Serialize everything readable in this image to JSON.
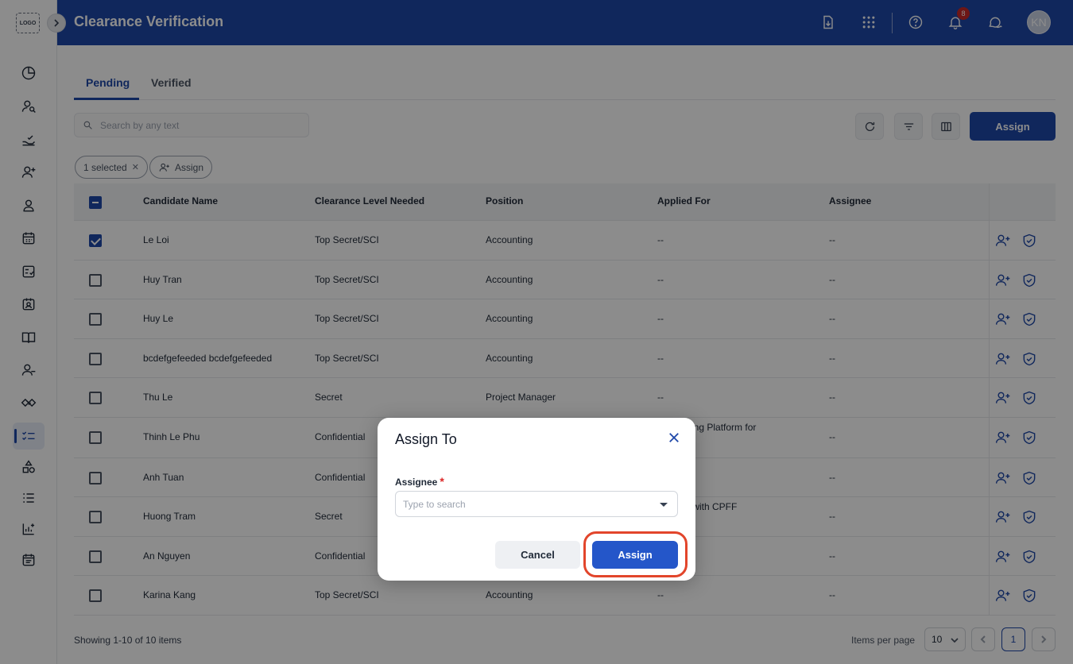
{
  "app": {
    "logo_text": "LOGO",
    "title": "Clearance Verification",
    "notification_count": "8",
    "user_initials": "KN"
  },
  "sidebar": {
    "items": [
      {
        "icon": "pie-chart-icon"
      },
      {
        "icon": "user-search-icon"
      },
      {
        "icon": "hand-check-icon"
      },
      {
        "icon": "user-add-icon"
      },
      {
        "icon": "user-icon"
      },
      {
        "icon": "calendar-icon"
      },
      {
        "icon": "checklist-doc-icon"
      },
      {
        "icon": "contact-card-icon"
      },
      {
        "icon": "book-open-icon"
      },
      {
        "icon": "user-minus-icon"
      },
      {
        "icon": "handshake-icon"
      },
      {
        "icon": "list-check-icon",
        "active": true
      },
      {
        "icon": "shapes-icon"
      },
      {
        "icon": "numbered-list-icon"
      },
      {
        "icon": "chart-add-icon"
      },
      {
        "icon": "calendar-notes-icon"
      }
    ]
  },
  "tabs": [
    {
      "label": "Pending",
      "active": true
    },
    {
      "label": "Verified",
      "active": false
    }
  ],
  "search": {
    "placeholder": "Search by any text"
  },
  "toolbar": {
    "assign_label": "Assign"
  },
  "selection": {
    "selected_label": "1 selected",
    "assign_label": "Assign"
  },
  "table": {
    "columns": [
      "Candidate Name",
      "Clearance Level Needed",
      "Position",
      "Applied For",
      "Assignee"
    ],
    "rows": [
      {
        "name": "Le Loi",
        "clearance": "Top Secret/SCI",
        "position": "Accounting",
        "applied_for": "--",
        "assignee": "--",
        "checked": true
      },
      {
        "name": "Huy Tran",
        "clearance": "Top Secret/SCI",
        "position": "Accounting",
        "applied_for": "--",
        "assignee": "--",
        "checked": false
      },
      {
        "name": "Huy Le",
        "clearance": "Top Secret/SCI",
        "position": "Accounting",
        "applied_for": "--",
        "assignee": "--",
        "checked": false
      },
      {
        "name": "bcdefgefeeded bcdefgefeeded",
        "clearance": "Top Secret/SCI",
        "position": "Accounting",
        "applied_for": "--",
        "assignee": "--",
        "checked": false
      },
      {
        "name": "Thu Le",
        "clearance": "Secret",
        "position": "Project Manager",
        "applied_for": "--",
        "assignee": "--",
        "checked": false
      },
      {
        "name": "Thinh Le Phu",
        "clearance": "Confidential",
        "position": "",
        "applied_for": "eting Platform for",
        "assignee": "--",
        "checked": false
      },
      {
        "name": "Anh Tuan",
        "clearance": "Confidential",
        "position": "",
        "applied_for": "",
        "assignee": "--",
        "checked": false
      },
      {
        "name": "Huong Tram",
        "clearance": "Secret",
        "position": "",
        "applied_for": "X with CPFF",
        "assignee": "--",
        "checked": false
      },
      {
        "name": "An Nguyen",
        "clearance": "Confidential",
        "position": "",
        "applied_for": "",
        "assignee": "--",
        "checked": false
      },
      {
        "name": "Karina Kang",
        "clearance": "Top Secret/SCI",
        "position": "Accounting",
        "applied_for": "--",
        "assignee": "--",
        "checked": false
      }
    ]
  },
  "footer": {
    "showing": "Showing 1-10 of 10 items",
    "items_per_page_label": "Items per page",
    "items_per_page_value": "10",
    "current_page": "1"
  },
  "modal": {
    "title": "Assign To",
    "assignee_label": "Assignee",
    "required_mark": "*",
    "assignee_placeholder": "Type to search",
    "cancel_label": "Cancel",
    "assign_label": "Assign"
  },
  "colors": {
    "brand": "#1e47a8",
    "highlight": "#e2452b"
  }
}
